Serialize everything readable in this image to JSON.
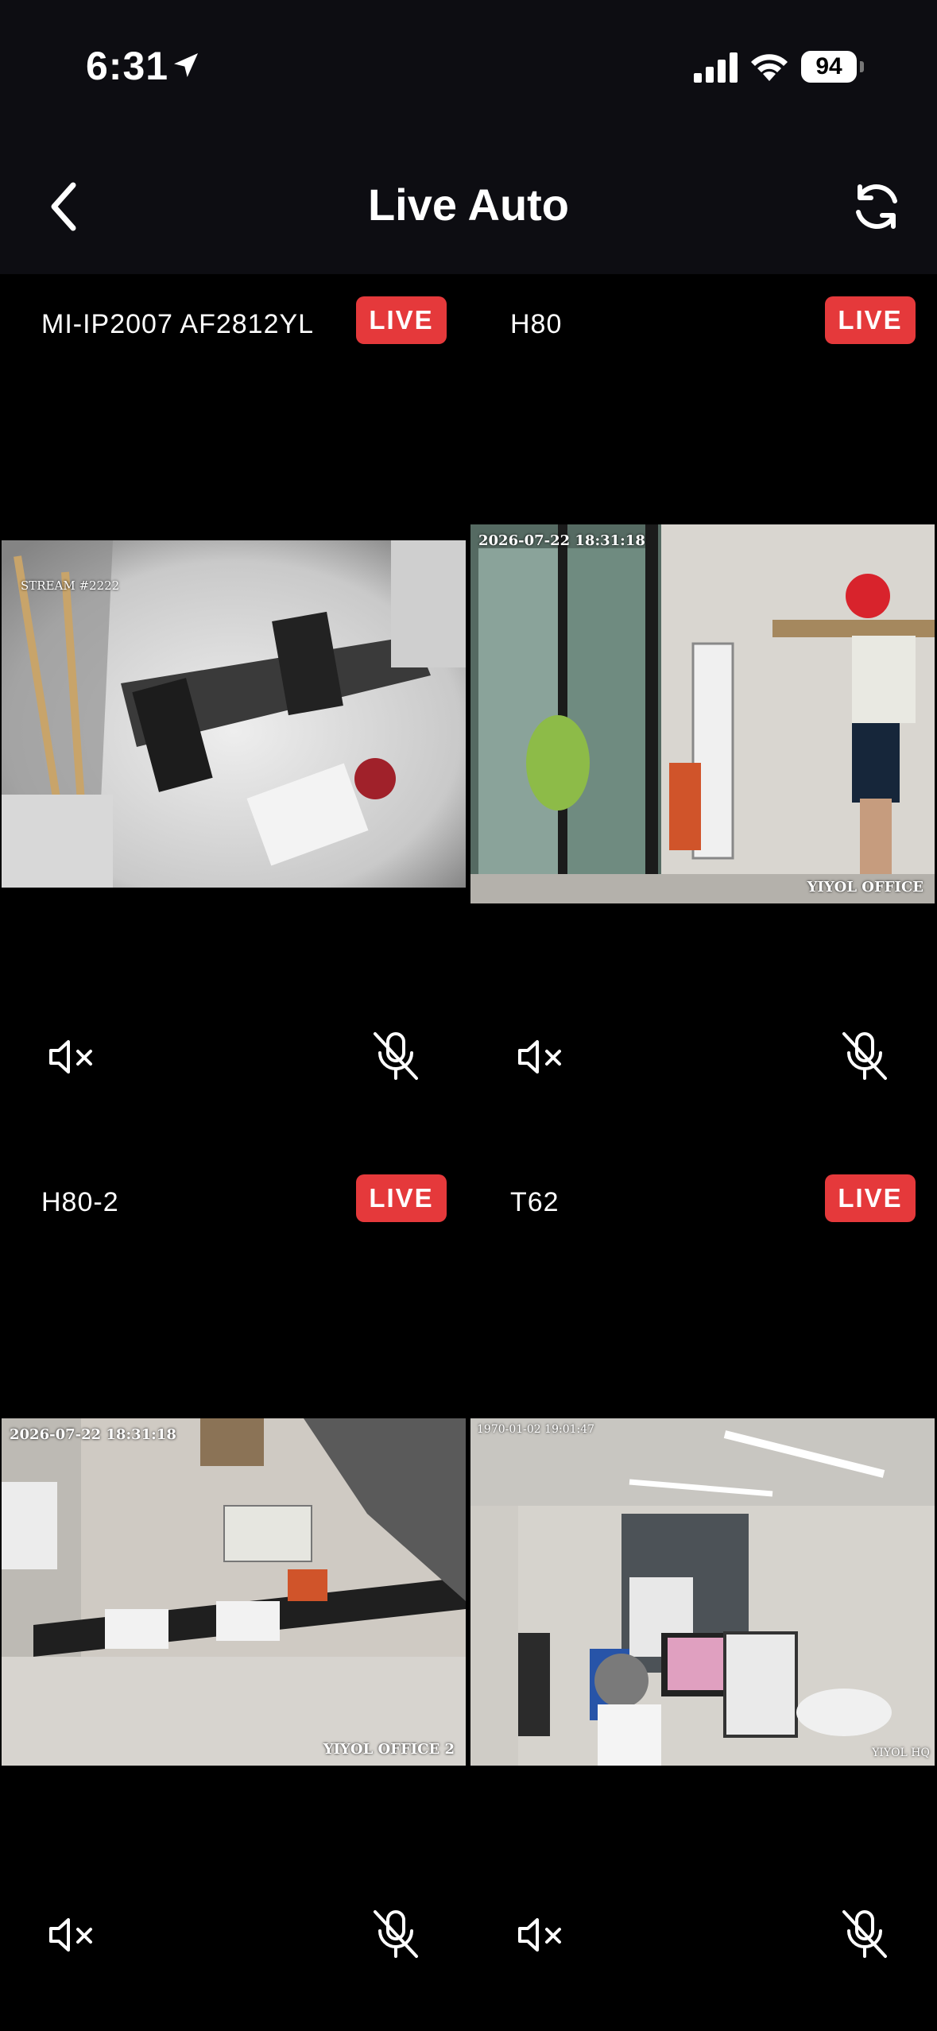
{
  "status_bar": {
    "time": "6:31",
    "battery": "94"
  },
  "header": {
    "title": "Live Auto",
    "back_icon": "chevron-left-icon",
    "refresh_icon": "refresh-icon"
  },
  "cameras": [
    {
      "name": "MI-IP2007 AF2812YL",
      "badge": "LIVE",
      "osd_top": "STREAM #2222",
      "osd_bottom": ""
    },
    {
      "name": "H80",
      "badge": "LIVE",
      "osd_top": "2026-07-22 18:31:18",
      "osd_bottom": "YIYOL OFFICE"
    },
    {
      "name": "H80-2",
      "badge": "LIVE",
      "osd_top": "2026-07-22 18:31:18",
      "osd_bottom": "YIYOL OFFICE 2"
    },
    {
      "name": "T62",
      "badge": "LIVE",
      "osd_top": "1970-01-02 19:01:47",
      "osd_bottom": "YIYOL HQ"
    }
  ],
  "colors": {
    "live_badge": "#e5393b",
    "bar_bg": "#0d0d12",
    "background": "#000000"
  }
}
